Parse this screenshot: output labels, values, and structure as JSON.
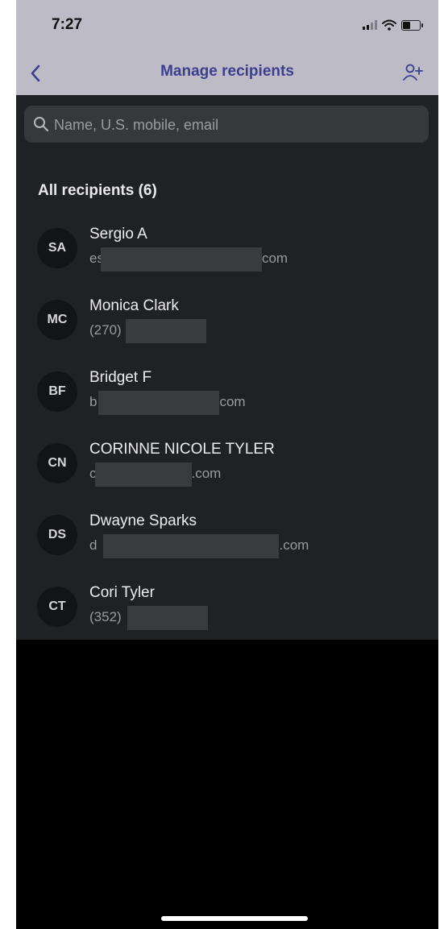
{
  "status_bar": {
    "time": "7:27"
  },
  "header": {
    "title": "Manage recipients"
  },
  "search": {
    "placeholder": "Name, U.S. mobile, email",
    "value": ""
  },
  "section": {
    "title": "All recipients (6)"
  },
  "recipients": [
    {
      "initials": "SA",
      "name": "Sergio A",
      "detail_prefix": "es",
      "detail_suffix": "com"
    },
    {
      "initials": "MC",
      "name": "Monica Clark",
      "detail_prefix": "(270)",
      "detail_suffix": ""
    },
    {
      "initials": "BF",
      "name": "Bridget F",
      "detail_prefix": "b",
      "detail_suffix": "com"
    },
    {
      "initials": "CN",
      "name": "CORINNE NICOLE TYLER",
      "detail_prefix": "c",
      "detail_suffix": ".com"
    },
    {
      "initials": "DS",
      "name": "Dwayne Sparks",
      "detail_prefix": "d",
      "detail_suffix": ".com"
    },
    {
      "initials": "CT",
      "name": "Cori Tyler",
      "detail_prefix": "(352)",
      "detail_suffix": ""
    }
  ],
  "colors": {
    "accent": "#3d3f8e",
    "header_background": "#bcbbc6",
    "list_background": "#202124",
    "avatar_background": "#131416"
  },
  "icons": {
    "back": "chevron-left-icon",
    "add_person": "add-person-icon",
    "search": "search-icon"
  }
}
